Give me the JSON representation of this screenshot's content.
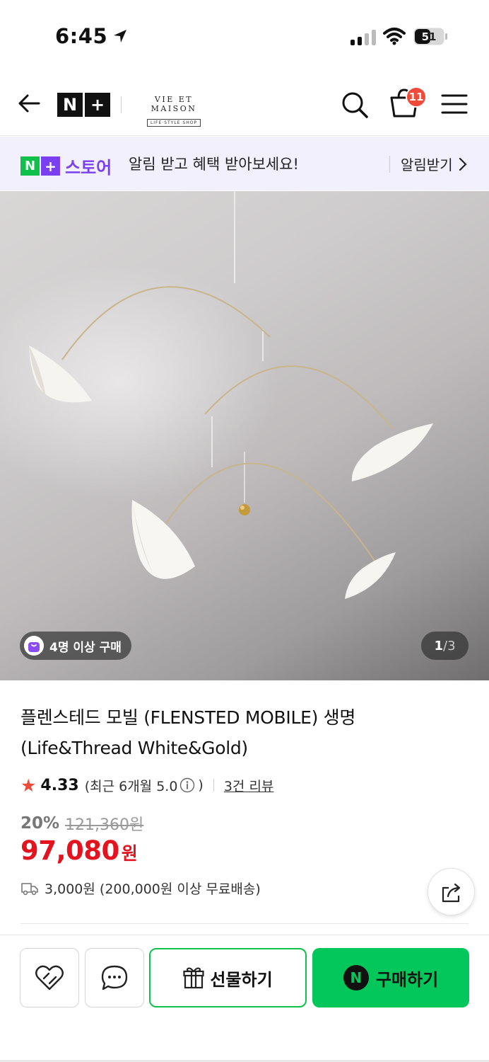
{
  "status_bar": {
    "time": "6:45",
    "battery_level": "51"
  },
  "header": {
    "brand_logo_text": "N+",
    "shop_name": "VIE ET MAISON",
    "shop_tagline": "LIFE·STYLE SHOP",
    "cart_count": "11"
  },
  "promo_banner": {
    "store_logo_label": "스토어",
    "message": "알림 받고 혜택 받아보세요!",
    "cta_label": "알림받기"
  },
  "product_image": {
    "buyers_badge": "4명 이상 구매",
    "current_page": "1",
    "total_pages": "/3"
  },
  "product": {
    "title": "플렌스테드 모빌 (FLENSTED MOBILE) 생명 (Life&Thread White&Gold)",
    "rating": "4.33",
    "recent_rating_prefix": "(최근 6개월 5.0",
    "recent_rating_suffix": ")",
    "review_link": "3건 리뷰",
    "discount_rate": "20%",
    "original_price": "121,360원",
    "sale_price": "97,080",
    "currency": "원",
    "shipping": "3,000원 (200,000원 이상 무료배송)"
  },
  "actions": {
    "gift_label": "선물하기",
    "buy_label": "구매하기",
    "buy_logo": "N"
  },
  "colors": {
    "naver_green": "#03c75a",
    "store_purple": "#7b3ff2",
    "price_red": "#e4141f",
    "badge_red": "#f04b3a"
  }
}
